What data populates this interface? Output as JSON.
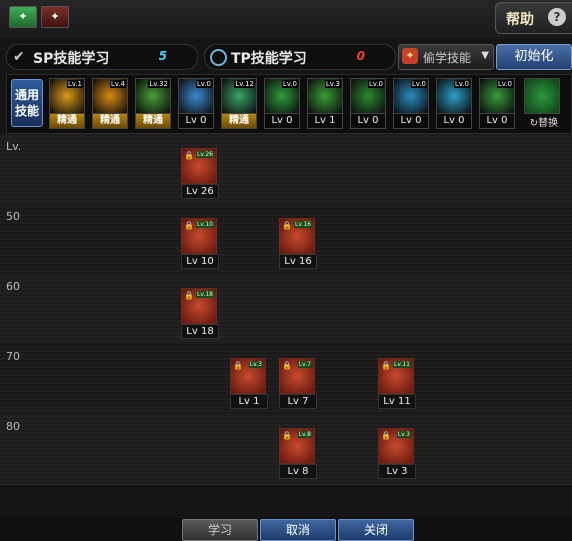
{
  "topbar": {
    "left_btn_green_glyph": "✦",
    "left_btn_red_glyph": "✦",
    "help_label": "帮助",
    "help_icon_glyph": "?"
  },
  "sp": {
    "label": "SP技能学习",
    "value": "5",
    "icon": "check-icon"
  },
  "tp": {
    "label": "TP技能学习",
    "value": "0",
    "icon": "ring-icon"
  },
  "steal": {
    "label": "偷学技能",
    "icon_glyph": "✦",
    "arrow": "▼"
  },
  "init_label": "初始化",
  "common_skills_label": "通用技能",
  "swap_label": "↻替换",
  "bar_skills": [
    {
      "tag": "Lv.1",
      "level": "精通",
      "master": true,
      "color": "#d99a1a"
    },
    {
      "tag": "Lv.4",
      "level": "精通",
      "master": true,
      "color": "#d98a12"
    },
    {
      "tag": "Lv.32",
      "level": "精通",
      "master": true,
      "color": "#47a035"
    },
    {
      "tag": "Lv.0",
      "level": "Lv 0",
      "master": false,
      "color": "#3a8bd1"
    },
    {
      "tag": "Lv.12",
      "level": "精通",
      "master": true,
      "color": "#3aa56b"
    },
    {
      "tag": "Lv.0",
      "level": "Lv 0",
      "master": false,
      "color": "#2f9d3c"
    },
    {
      "tag": "Lv.3",
      "level": "Lv 1",
      "master": false,
      "color": "#3c9d35"
    },
    {
      "tag": "Lv.0",
      "level": "Lv 0",
      "master": false,
      "color": "#2c8a30"
    },
    {
      "tag": "Lv.0",
      "level": "Lv 0",
      "master": false,
      "color": "#2a8cc0"
    },
    {
      "tag": "Lv.0",
      "level": "Lv 0",
      "master": false,
      "color": "#2aa0c8"
    },
    {
      "tag": "Lv.0",
      "level": "Lv 0",
      "master": false,
      "color": "#379a3b"
    }
  ],
  "rows": [
    {
      "label": "Lv."
    },
    {
      "label": "50"
    },
    {
      "label": "60"
    },
    {
      "label": "70"
    },
    {
      "label": "80"
    }
  ],
  "tree_nodes": [
    {
      "row": 0,
      "col": 0,
      "level": "Lv 26",
      "tag": "Lv.26"
    },
    {
      "row": 1,
      "col": 0,
      "level": "Lv 10",
      "tag": "Lv.10"
    },
    {
      "row": 1,
      "col": 2,
      "level": "Lv 16",
      "tag": "Lv.16"
    },
    {
      "row": 2,
      "col": 0,
      "level": "Lv 18",
      "tag": "Lv.18"
    },
    {
      "row": 3,
      "col": 1,
      "level": "Lv 1",
      "tag": "Lv.3"
    },
    {
      "row": 3,
      "col": 2,
      "level": "Lv 7",
      "tag": "Lv.7"
    },
    {
      "row": 3,
      "col": 4,
      "level": "Lv 11",
      "tag": "Lv.11"
    },
    {
      "row": 4,
      "col": 2,
      "level": "Lv 8",
      "tag": "Lv.8"
    },
    {
      "row": 4,
      "col": 4,
      "level": "Lv 3",
      "tag": "Lv.3"
    }
  ],
  "buttons": {
    "learn": "学习",
    "cancel": "取消",
    "close": "关闭"
  }
}
